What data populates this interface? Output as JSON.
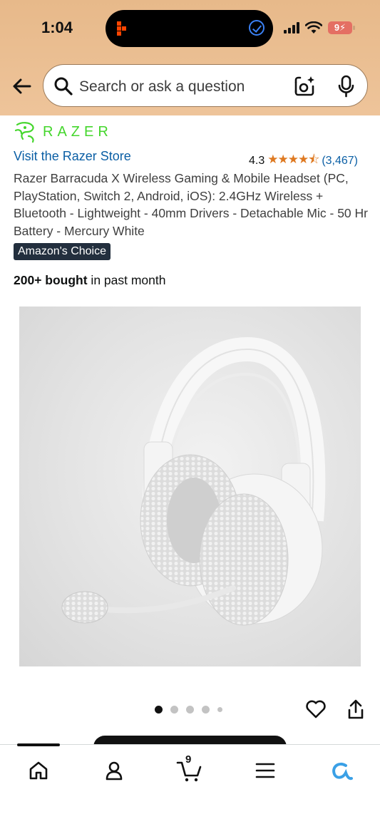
{
  "status_bar": {
    "time": "1:04",
    "battery": "9"
  },
  "search": {
    "placeholder": "Search or ask a question"
  },
  "product": {
    "brand": "RAZER",
    "store_link": "Visit the Razer Store",
    "rating": "4.3",
    "stars": "★★★★⯪",
    "rating_count": "(3,467)",
    "title": "Razer Barracuda X Wireless Gaming & Mobile Headset (PC, PlayStation, Switch 2, Android, iOS): 2.4GHz Wireless + Bluetooth - Lightweight - 40mm Drivers - Detachable Mic - 50 Hr Battery - Mercury White",
    "badge": "Amazon's Choice",
    "bought_bold": "200+ bought",
    "bought_rest": " in past month",
    "image_count": 5,
    "active_image": 1
  },
  "bottom_nav": {
    "items": [
      "home-icon",
      "account-icon",
      "cart-icon",
      "menu-icon",
      "rufus-icon"
    ],
    "cart_count": "9"
  },
  "colors": {
    "header_bg": "#eec49a",
    "brand_green": "#44d62c",
    "link": "#0b5fa5",
    "star": "#de7921",
    "badge_bg": "#232f3e"
  }
}
